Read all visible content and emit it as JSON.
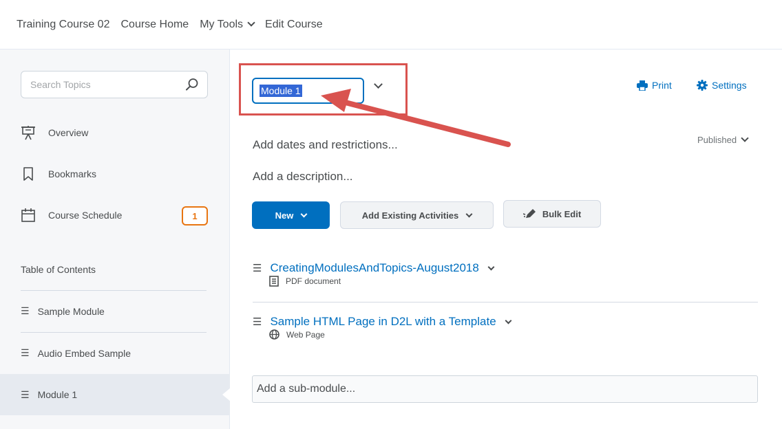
{
  "nav": {
    "items": [
      {
        "label": "Training Course 02"
      },
      {
        "label": "Course Home"
      },
      {
        "label": "My Tools"
      },
      {
        "label": "Edit Course"
      }
    ]
  },
  "sidebar": {
    "search_placeholder": "Search Topics",
    "items": [
      {
        "label": "Overview",
        "icon": "overview-icon"
      },
      {
        "label": "Bookmarks",
        "icon": "bookmark-icon"
      },
      {
        "label": "Course Schedule",
        "icon": "calendar-icon",
        "badge": "1"
      }
    ],
    "toc_title": "Table of Contents",
    "toc_items": [
      {
        "label": "Sample Module"
      },
      {
        "label": "Audio Embed Sample"
      },
      {
        "label": "Module 1",
        "active": true
      }
    ]
  },
  "main": {
    "module_title": "Module 1",
    "print_label": "Print",
    "settings_label": "Settings",
    "dates_link": "Add dates and restrictions...",
    "description_link": "Add a description...",
    "published_label": "Published",
    "buttons": {
      "new": "New",
      "add_existing": "Add Existing Activities",
      "bulk_edit": "Bulk Edit"
    },
    "topics": [
      {
        "title": "CreatingModulesAndTopics-August2018",
        "type": "PDF document",
        "icon": "document-icon"
      },
      {
        "title": "Sample HTML Page in D2L with a Template",
        "type": "Web Page",
        "icon": "globe-icon"
      }
    ],
    "submodule_placeholder": "Add a sub-module..."
  },
  "colors": {
    "accent": "#006fbf",
    "badge": "#e87511",
    "annotation": "#d9534f"
  }
}
